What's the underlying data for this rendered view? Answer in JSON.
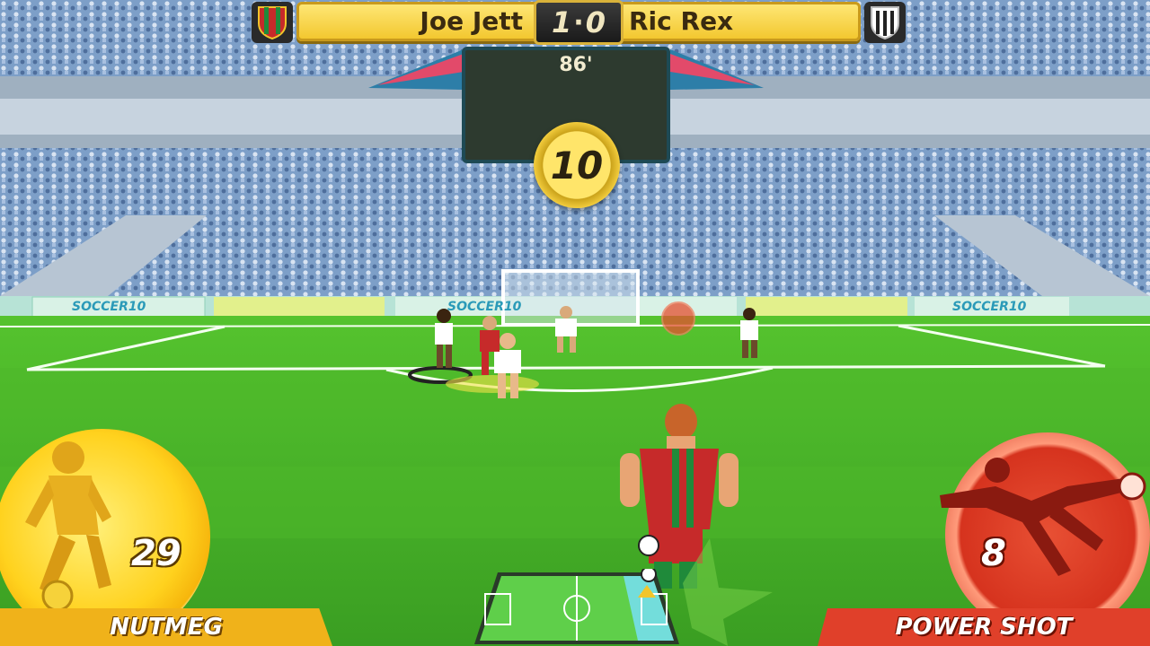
{
  "scoreboard": {
    "home_team": "Joe Jett",
    "away_team": "Ric Rex",
    "home_score": "1",
    "away_score": "0",
    "match_time": "86'"
  },
  "turn_timer": "10",
  "stadium_ads": [
    "SOCCER10",
    "SOCCER10",
    "SOCCER10"
  ],
  "abilities": {
    "nutmeg": {
      "label": "NUTMEG",
      "count": "29",
      "color": "#f6c21a"
    },
    "power_shot": {
      "label": "POWER SHOT",
      "count": "8",
      "color": "#d6331e"
    }
  },
  "colors": {
    "pitch": "#3fae2a",
    "home_kit": "#c62a2a",
    "away_kit": "#ffffff"
  }
}
